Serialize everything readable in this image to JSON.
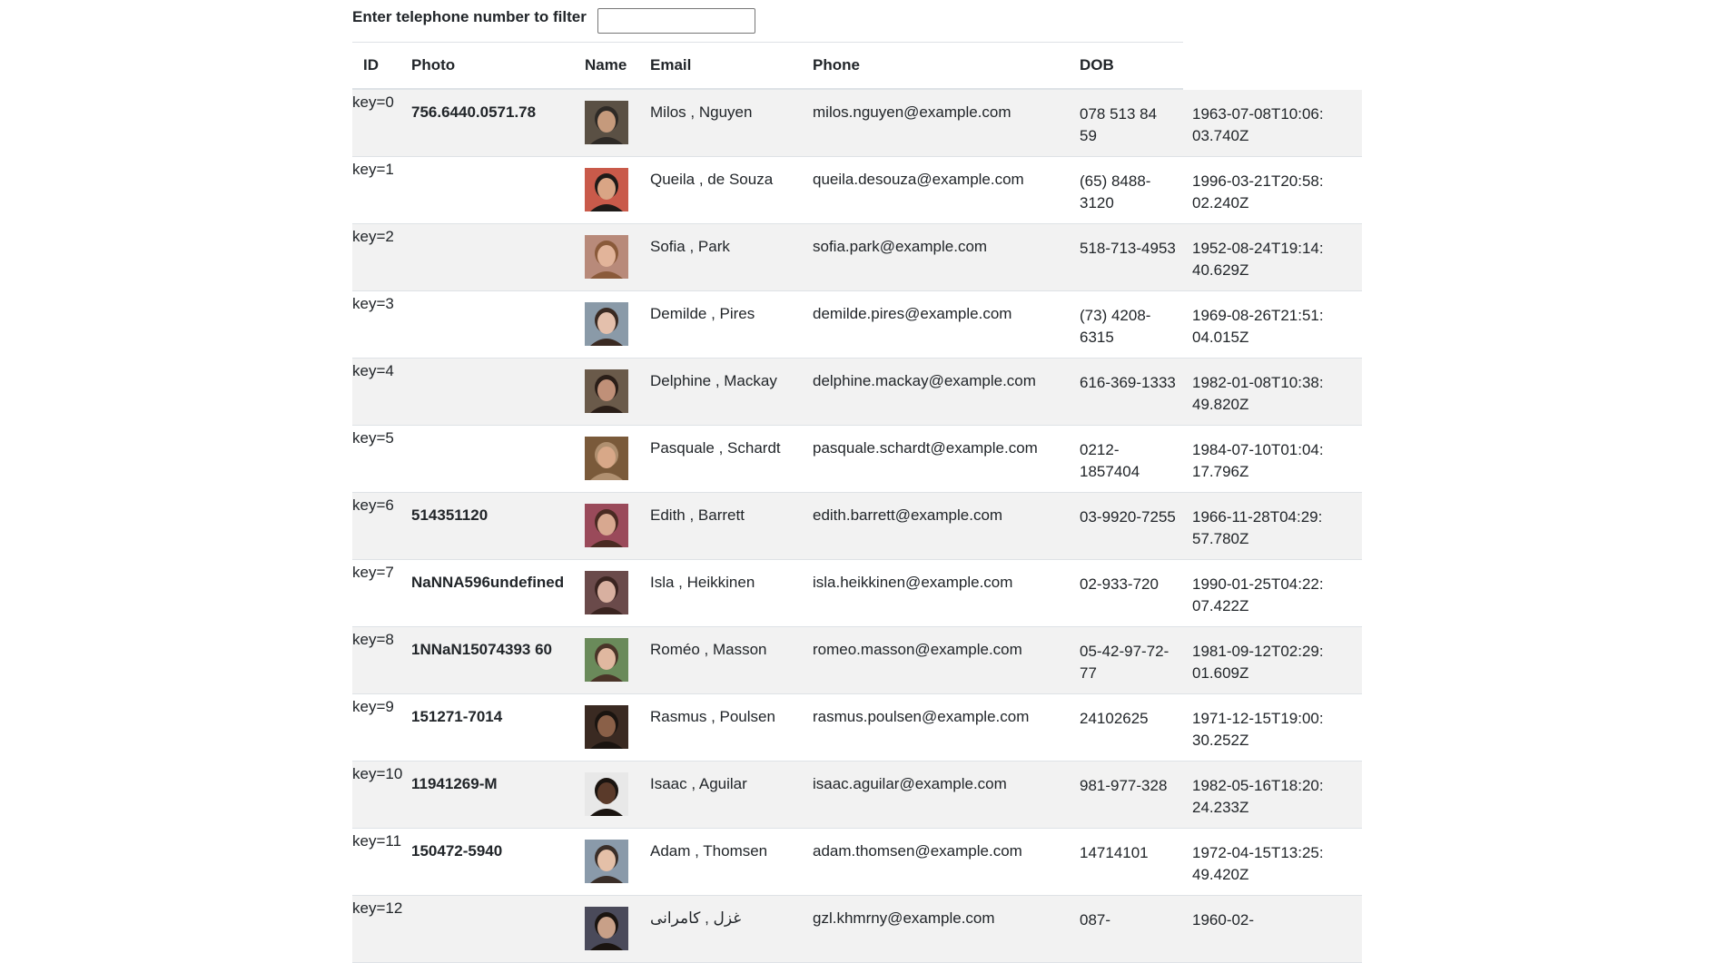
{
  "filter": {
    "label": "Enter telephone number to filter",
    "value": ""
  },
  "columns": [
    "ID",
    "Photo",
    "Name",
    "Email",
    "Phone",
    "DOB"
  ],
  "rows": [
    {
      "key": "key=0",
      "id": "756.6440.0571.78",
      "name": "Milos , Nguyen",
      "email": "milos.nguyen@example.com",
      "phone": "078 513 84 59",
      "dob": "1963-07-08T10:06:03.740Z",
      "avatar": {
        "bg": "#5a5044",
        "skin": "#c59a7c",
        "hair": "#2e2a26"
      }
    },
    {
      "key": "key=1",
      "id": "",
      "name": "Queila , de Souza",
      "email": "queila.desouza@example.com",
      "phone": "(65) 8488-3120",
      "dob": "1996-03-21T20:58:02.240Z",
      "avatar": {
        "bg": "#c95a4a",
        "skin": "#d9a585",
        "hair": "#1e1a18"
      }
    },
    {
      "key": "key=2",
      "id": "",
      "name": "Sofia , Park",
      "email": "sofia.park@example.com",
      "phone": "518-713-4953",
      "dob": "1952-08-24T19:14:40.629Z",
      "avatar": {
        "bg": "#b88a7a",
        "skin": "#e2b49a",
        "hair": "#8a5a3a"
      }
    },
    {
      "key": "key=3",
      "id": "",
      "name": "Demilde , Pires",
      "email": "demilde.pires@example.com",
      "phone": "(73) 4208-6315",
      "dob": "1969-08-26T21:51:04.015Z",
      "avatar": {
        "bg": "#8a9aa8",
        "skin": "#e4c0ac",
        "hair": "#3a2a22"
      }
    },
    {
      "key": "key=4",
      "id": "",
      "name": "Delphine , Mackay",
      "email": "delphine.mackay@example.com",
      "phone": "616-369-1333",
      "dob": "1982-01-08T10:38:49.820Z",
      "avatar": {
        "bg": "#6a5a4a",
        "skin": "#c09078",
        "hair": "#2a1e18"
      }
    },
    {
      "key": "key=5",
      "id": "",
      "name": "Pasquale , Schardt",
      "email": "pasquale.schardt@example.com",
      "phone": "0212-1857404",
      "dob": "1984-07-10T01:04:17.796Z",
      "avatar": {
        "bg": "#7a5a3a",
        "skin": "#d8a888",
        "hair": "#b09070"
      }
    },
    {
      "key": "key=6",
      "id": "514351120",
      "name": "Edith , Barrett",
      "email": "edith.barrett@example.com",
      "phone": "03-9920-7255",
      "dob": "1966-11-28T04:29:57.780Z",
      "avatar": {
        "bg": "#9a4a5a",
        "skin": "#d8a890",
        "hair": "#4a2a22"
      }
    },
    {
      "key": "key=7",
      "id": "NaNNA596undefined",
      "name": "Isla , Heikkinen",
      "email": "isla.heikkinen@example.com",
      "phone": "02-933-720",
      "dob": "1990-01-25T04:22:07.422Z",
      "avatar": {
        "bg": "#6a4a4a",
        "skin": "#d8b0a0",
        "hair": "#3a2420"
      }
    },
    {
      "key": "key=8",
      "id": "1NNaN15074393 60",
      "name": "Roméo , Masson",
      "email": "romeo.masson@example.com",
      "phone": "05-42-97-72-77",
      "dob": "1981-09-12T02:29:01.609Z",
      "avatar": {
        "bg": "#6a8a5a",
        "skin": "#e0b8a0",
        "hair": "#4a3428"
      }
    },
    {
      "key": "key=9",
      "id": "151271-7014",
      "name": "Rasmus , Poulsen",
      "email": "rasmus.poulsen@example.com",
      "phone": "24102625",
      "dob": "1971-12-15T19:00:30.252Z",
      "avatar": {
        "bg": "#3a2a22",
        "skin": "#8a6048",
        "hair": "#1a1410"
      }
    },
    {
      "key": "key=10",
      "id": "11941269-M",
      "name": "Isaac , Aguilar",
      "email": "isaac.aguilar@example.com",
      "phone": "981-977-328",
      "dob": "1982-05-16T18:20:24.233Z",
      "avatar": {
        "bg": "#e8e8e8",
        "skin": "#5a3a2a",
        "hair": "#1a1410"
      }
    },
    {
      "key": "key=11",
      "id": "150472-5940",
      "name": "Adam , Thomsen",
      "email": "adam.thomsen@example.com",
      "phone": "14714101",
      "dob": "1972-04-15T13:25:49.420Z",
      "avatar": {
        "bg": "#8a9aaa",
        "skin": "#e4c0a8",
        "hair": "#3a2e28"
      }
    },
    {
      "key": "key=12",
      "id": "",
      "name": "غزل , کامرانی",
      "email": "gzl.khmrny@example.com",
      "phone": "087-",
      "dob": "1960-02-",
      "avatar": {
        "bg": "#4a4a5a",
        "skin": "#c8a088",
        "hair": "#1a1410"
      }
    }
  ]
}
